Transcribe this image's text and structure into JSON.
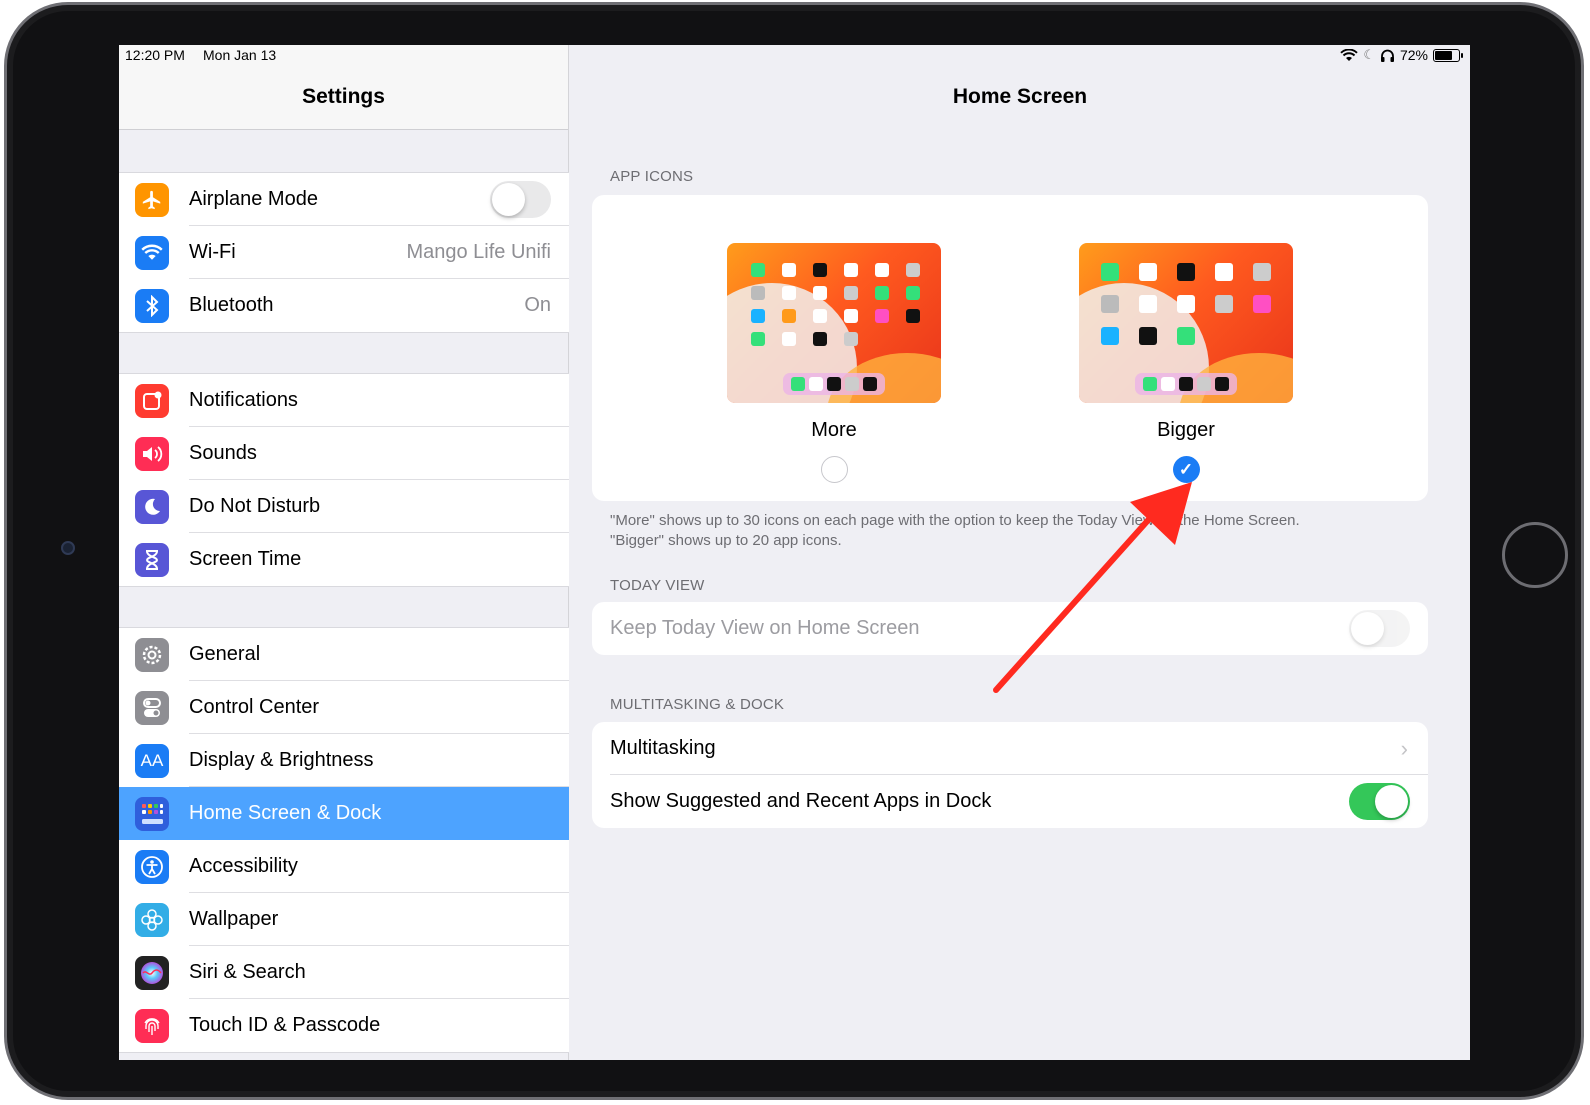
{
  "status_bar": {
    "time": "12:20 PM",
    "date": "Mon Jan 13",
    "battery": "72%"
  },
  "sidebar": {
    "title": "Settings",
    "groups": [
      [
        {
          "label": "Airplane Mode",
          "icon": "airplane-icon",
          "color": "#ff9500",
          "toggle": false
        },
        {
          "label": "Wi-Fi",
          "icon": "wifi-icon",
          "color": "#1a7cf5",
          "value": "Mango Life Unifi"
        },
        {
          "label": "Bluetooth",
          "icon": "bluetooth-icon",
          "color": "#1a7cf5",
          "value": "On"
        }
      ],
      [
        {
          "label": "Notifications",
          "icon": "notifications-icon",
          "color": "#ff3b30"
        },
        {
          "label": "Sounds",
          "icon": "speaker-icon",
          "color": "#ff2d55"
        },
        {
          "label": "Do Not Disturb",
          "icon": "moon-icon",
          "color": "#5856d6"
        },
        {
          "label": "Screen Time",
          "icon": "hourglass-icon",
          "color": "#5856d6"
        }
      ],
      [
        {
          "label": "General",
          "icon": "gear-icon",
          "color": "#8e8e93"
        },
        {
          "label": "Control Center",
          "icon": "switches-icon",
          "color": "#8e8e93"
        },
        {
          "label": "Display & Brightness",
          "icon": "text-size-icon",
          "color": "#1a7cf5"
        },
        {
          "label": "Home Screen & Dock",
          "icon": "home-grid-icon",
          "color": "#2f5fdc",
          "selected": true
        },
        {
          "label": "Accessibility",
          "icon": "accessibility-icon",
          "color": "#1a7cf5"
        },
        {
          "label": "Wallpaper",
          "icon": "flower-icon",
          "color": "#32ade6"
        },
        {
          "label": "Siri & Search",
          "icon": "siri-icon",
          "color": "#222222"
        },
        {
          "label": "Touch ID & Passcode",
          "icon": "fingerprint-icon",
          "color": "#ff2d55"
        }
      ]
    ]
  },
  "detail": {
    "title": "Home Screen",
    "app_icons": {
      "header": "APP ICONS",
      "options": [
        {
          "label": "More",
          "checked": false
        },
        {
          "label": "Bigger",
          "checked": true
        }
      ],
      "footnote_1": "\"More\" shows up to 30 icons on each page with the option to keep the Today View on the Home Screen.",
      "footnote_2": "\"Bigger\" shows up to 20 app icons."
    },
    "today_view": {
      "header": "TODAY VIEW",
      "row_label": "Keep Today View on Home Screen",
      "toggle": false
    },
    "multitasking": {
      "header": "MULTITASKING & DOCK",
      "row1_label": "Multitasking",
      "row2_label": "Show Suggested and Recent Apps in Dock",
      "row2_toggle": true
    }
  },
  "annotation": {
    "arrow_color": "#ff2a1f"
  }
}
